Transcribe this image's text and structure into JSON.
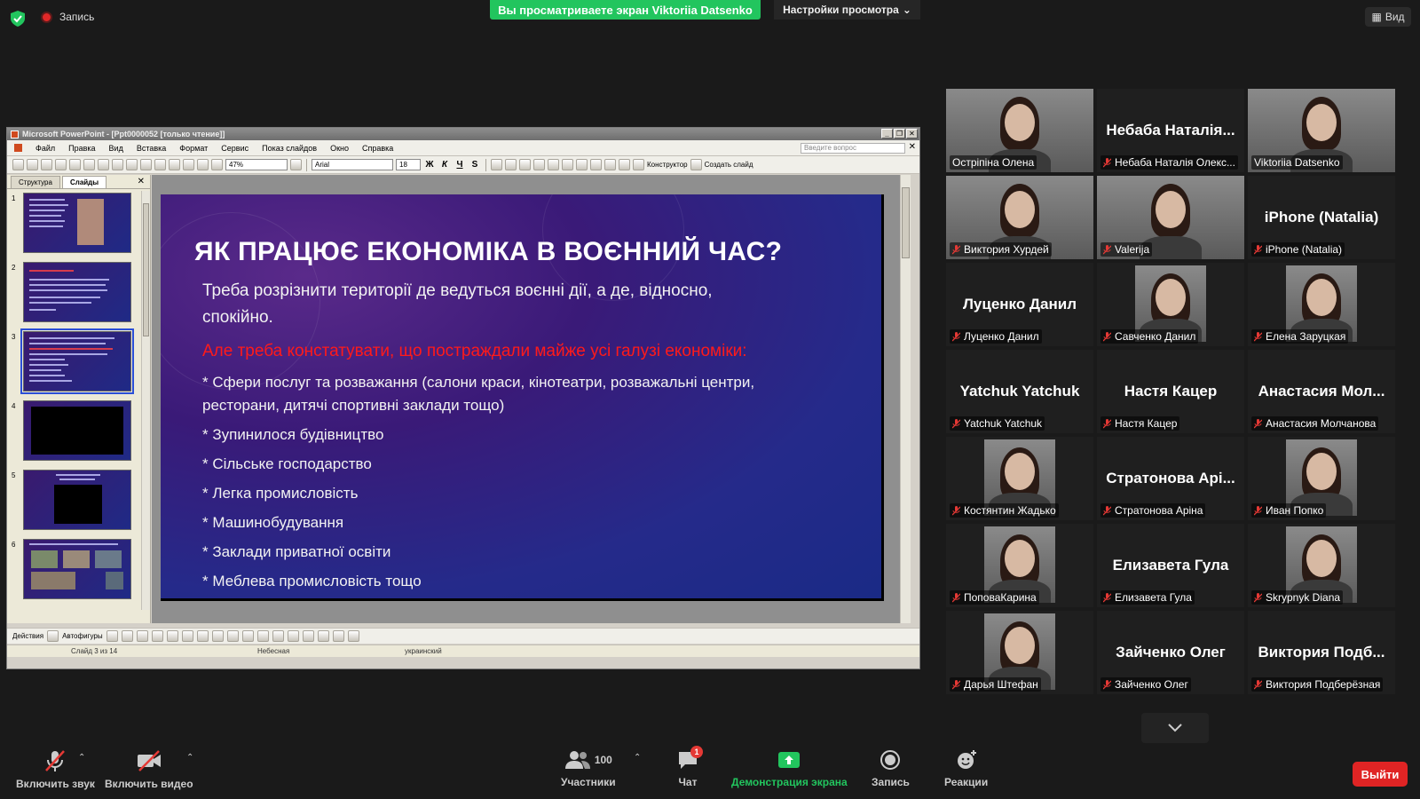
{
  "top": {
    "recording_label": "Запись",
    "viewing_banner": "Вы просматриваете экран Viktoriia Datsenko",
    "view_options": "Настройки просмотра",
    "view_button": "Вид"
  },
  "ppt": {
    "window_title": "Microsoft PowerPoint - [Ppt0000052 [только чтение]]",
    "menu": [
      "Файл",
      "Правка",
      "Вид",
      "Вставка",
      "Формат",
      "Сервис",
      "Показ слайдов",
      "Окно",
      "Справка"
    ],
    "help_placeholder": "Введите вопрос",
    "zoom": "47%",
    "font_name": "Arial",
    "font_size": "18",
    "bold_label": "Ж",
    "italic_label": "К",
    "underline_label": "Ч",
    "shadow_label": "S",
    "designer_label": "Конструктор",
    "new_slide_label": "Создать слайд",
    "tab_outline": "Структура",
    "tab_slides": "Слайды",
    "thumb_numbers": [
      "1",
      "2",
      "3",
      "4",
      "5",
      "6"
    ],
    "draw_actions": "Действия",
    "draw_autoshapes": "Автофигуры",
    "status_slide": "Слайд 3 из 14",
    "status_design": "Небесная",
    "status_lang": "украинский"
  },
  "slide": {
    "title": "ЯК ПРАЦЮЄ ЕКОНОМІКА В ВОЄННИЙ ЧАС?",
    "line1": "Треба розрізнити території де ведуться воєнні дії, а де, відносно,",
    "line2": "спокійно.",
    "red_line": "Але треба констатувати, що постраждали майже усі галузі економіки:",
    "bullet1a": "* Сфери послуг та розважання (салони краси, кінотеатри, розважальні центри,",
    "bullet1b": "ресторани, дитячі спортивні заклади тощо)",
    "bullet2": "* Зупинилося будівництво",
    "bullet3": "* Сільське господарство",
    "bullet4": "* Легка промисловість",
    "bullet5": "* Машинобудування",
    "bullet6": "* Заклади приватної освіти",
    "bullet7": "* Меблева промисловість тощо"
  },
  "participants": [
    {
      "label": "Остріпіна Олена",
      "big": "",
      "photo": true,
      "active": true,
      "muted": false
    },
    {
      "label": "Небаба Наталія Олекс...",
      "big": "Небаба Наталія...",
      "photo": false,
      "active": false,
      "muted": true
    },
    {
      "label": "Viktoriia Datsenko",
      "big": "",
      "photo": true,
      "active": false,
      "muted": false
    },
    {
      "label": "Виктория Хурдей",
      "big": "",
      "photo": true,
      "active": false,
      "muted": true
    },
    {
      "label": "Valerija",
      "big": "",
      "photo": true,
      "active": false,
      "muted": true
    },
    {
      "label": "iPhone (Natalia)",
      "big": "iPhone (Natalia)",
      "photo": false,
      "active": false,
      "muted": true
    },
    {
      "label": "Луценко Данил",
      "big": "Луценко Данил",
      "photo": false,
      "active": false,
      "muted": true
    },
    {
      "label": "Савченко Данил",
      "big": "",
      "photo": true,
      "active": false,
      "muted": true
    },
    {
      "label": "Елена Заруцкая",
      "big": "",
      "photo": true,
      "active": false,
      "muted": true
    },
    {
      "label": "Yatchuk Yatchuk",
      "big": "Yatchuk Yatchuk",
      "photo": false,
      "active": false,
      "muted": true
    },
    {
      "label": "Настя Кацер",
      "big": "Настя Кацер",
      "photo": false,
      "active": false,
      "muted": true
    },
    {
      "label": "Анастасия Молчанова",
      "big": "Анастасия Мол...",
      "photo": false,
      "active": false,
      "muted": true
    },
    {
      "label": "Костянтин Жадько",
      "big": "",
      "photo": true,
      "active": false,
      "muted": true
    },
    {
      "label": "Стратонова Аріна",
      "big": "Стратонова Арі...",
      "photo": false,
      "active": false,
      "muted": true
    },
    {
      "label": "Иван Попко",
      "big": "",
      "photo": true,
      "active": false,
      "muted": true
    },
    {
      "label": "ПоповаКарина",
      "big": "",
      "photo": true,
      "active": false,
      "muted": true
    },
    {
      "label": "Елизавета Гула",
      "big": "Елизавета Гула",
      "photo": false,
      "active": false,
      "muted": true
    },
    {
      "label": "Skrypnyk Diana",
      "big": "",
      "photo": true,
      "active": false,
      "muted": true
    },
    {
      "label": "Дарья Штефан",
      "big": "",
      "photo": true,
      "active": false,
      "muted": true
    },
    {
      "label": "Зайченко Олег",
      "big": "Зайченко Олег",
      "photo": false,
      "active": false,
      "muted": true
    },
    {
      "label": "Виктория Подберёзная",
      "big": "Виктория Подб...",
      "photo": false,
      "active": false,
      "muted": true
    }
  ],
  "bottom": {
    "unmute": "Включить звук",
    "start_video": "Включить видео",
    "participants_label": "Участники",
    "participants_count": "100",
    "chat": "Чат",
    "chat_badge": "1",
    "share": "Демонстрация экрана",
    "record": "Запись",
    "reactions": "Реакции",
    "leave": "Выйти"
  },
  "colors": {
    "share_green": "#22c55e",
    "leave_red": "#e02424",
    "active_speaker": "#c9e13f"
  }
}
